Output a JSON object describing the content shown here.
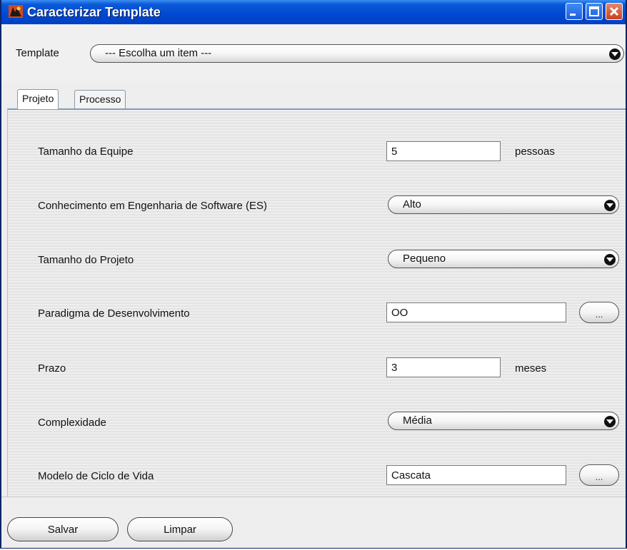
{
  "window": {
    "title": "Caracterizar Template"
  },
  "template": {
    "label": "Template",
    "selected": "--- Escolha um item ---"
  },
  "tabs": [
    {
      "label": "Projeto",
      "active": true
    },
    {
      "label": "Processo",
      "active": false
    }
  ],
  "form": {
    "tamanho_equipe": {
      "label": "Tamanho da Equipe",
      "value": "5",
      "unit": "pessoas"
    },
    "conhecimento_es": {
      "label": "Conhecimento em Engenharia de Software (ES)",
      "selected": "Alto"
    },
    "tamanho_projeto": {
      "label": "Tamanho do Projeto",
      "selected": "Pequeno"
    },
    "paradigma": {
      "label": "Paradigma de Desenvolvimento",
      "value": "OO",
      "button": "..."
    },
    "prazo": {
      "label": "Prazo",
      "value": "3",
      "unit": "meses"
    },
    "complexidade": {
      "label": "Complexidade",
      "selected": "Média"
    },
    "ciclo_vida": {
      "label": "Modelo de Ciclo de Vida",
      "value": "Cascata",
      "button": "..."
    }
  },
  "buttons": {
    "salvar": "Salvar",
    "limpar": "Limpar"
  },
  "colors": {
    "titlebar": "#0048d2",
    "close": "#c7421f",
    "tab_border": "#7f9db9"
  }
}
